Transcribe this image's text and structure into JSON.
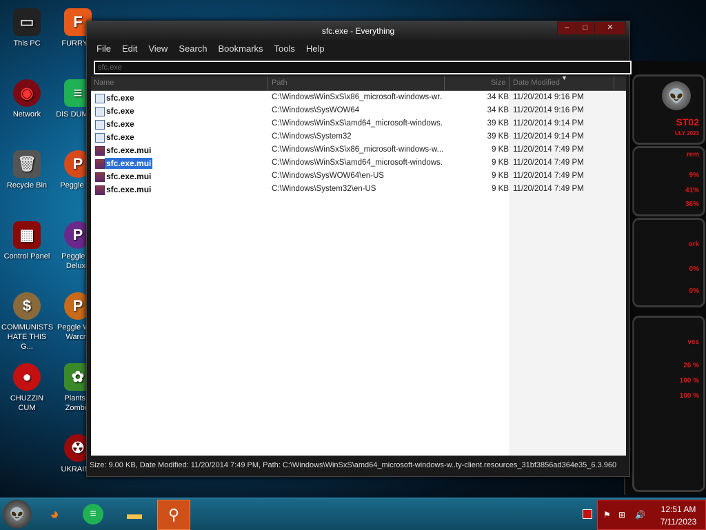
{
  "desktop": {
    "icons": [
      {
        "label": "This PC"
      },
      {
        "label": "FURRY F"
      },
      {
        "label": "Network"
      },
      {
        "label": "DIS DUMB A"
      },
      {
        "label": "Recycle Bin"
      },
      {
        "label": "Peggle De"
      },
      {
        "label": "Control Panel"
      },
      {
        "label": "Peggle Ni Deluxe"
      },
      {
        "label": "COMMUNISTS HATE THIS G..."
      },
      {
        "label": "Peggle W of Warcra"
      },
      {
        "label": "CHUZZIN CUM"
      },
      {
        "label": "Plants v Zombie"
      },
      {
        "label": "UKRAINE"
      }
    ]
  },
  "widgets": {
    "labels": [
      "ST02",
      "ULY 2023",
      "rem",
      "9%",
      "41%",
      "36%",
      "ork",
      "0%",
      "0%",
      "ves",
      "26 %",
      "100 %",
      "100 %"
    ]
  },
  "window": {
    "title": "sfc.exe - Everything",
    "menu": [
      "File",
      "Edit",
      "View",
      "Search",
      "Bookmarks",
      "Tools",
      "Help"
    ],
    "search_value": "sfc.exe",
    "columns": {
      "name": "Name",
      "path": "Path",
      "size": "Size",
      "date": "Date Modified"
    },
    "rows": [
      {
        "name": "sfc.exe",
        "type": "exe",
        "path": "C:\\Windows\\WinSxS\\x86_microsoft-windows-wr...",
        "size": "34 KB",
        "date": "11/20/2014 9:16 PM"
      },
      {
        "name": "sfc.exe",
        "type": "exe",
        "path": "C:\\Windows\\SysWOW64",
        "size": "34 KB",
        "date": "11/20/2014 9:16 PM"
      },
      {
        "name": "sfc.exe",
        "type": "exe",
        "path": "C:\\Windows\\WinSxS\\amd64_microsoft-windows...",
        "size": "39 KB",
        "date": "11/20/2014 9:14 PM"
      },
      {
        "name": "sfc.exe",
        "type": "exe",
        "path": "C:\\Windows\\System32",
        "size": "39 KB",
        "date": "11/20/2014 9:14 PM"
      },
      {
        "name": "sfc.exe.mui",
        "type": "mui",
        "path": "C:\\Windows\\WinSxS\\x86_microsoft-windows-w.....",
        "size": "9 KB",
        "date": "11/20/2014 7:49 PM"
      },
      {
        "name": "sfc.exe.mui",
        "type": "mui",
        "path": "C:\\Windows\\WinSxS\\amd64_microsoft-windows...",
        "size": "9 KB",
        "date": "11/20/2014 7:49 PM"
      },
      {
        "name": "sfc.exe.mui",
        "type": "mui",
        "path": "C:\\Windows\\SysWOW64\\en-US",
        "size": "9 KB",
        "date": "11/20/2014 7:49 PM"
      },
      {
        "name": "sfc.exe.mui",
        "type": "mui",
        "path": "C:\\Windows\\System32\\en-US",
        "size": "9 KB",
        "date": "11/20/2014 7:49 PM"
      }
    ],
    "selected_row": 5,
    "status": "Size: 9.00 KB, Date Modified: 11/20/2014 7:49 PM, Path: C:\\Windows\\WinSxS\\amd64_microsoft-windows-w..ty-client.resources_31bf3856ad364e35_6.3.960"
  },
  "taskbar": {
    "apps": [
      {
        "icon": "firefox-icon"
      },
      {
        "icon": "chat-app-icon"
      },
      {
        "icon": "file-explorer-icon"
      },
      {
        "icon": "everything-search-icon",
        "active": true
      }
    ],
    "time": "12:51 AM",
    "date": "7/11/2023"
  },
  "colors": {
    "accent": "#c41010",
    "selection": "#2b6fd6",
    "taskbar": "#1b6a8a"
  }
}
